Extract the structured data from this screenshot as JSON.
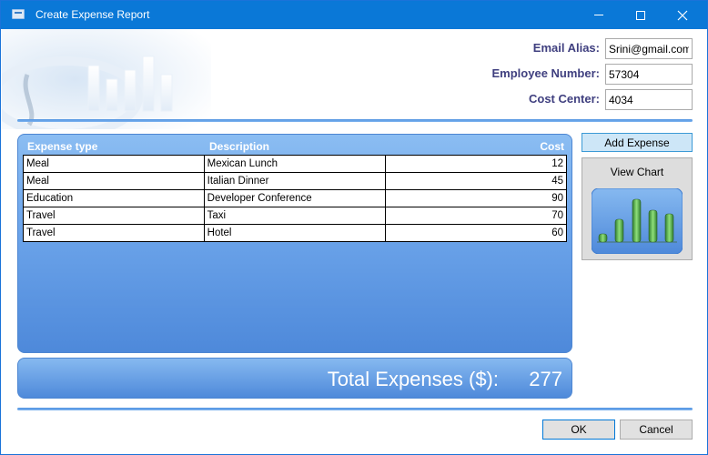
{
  "window": {
    "title": "Create Expense Report",
    "controls": [
      "minimize",
      "maximize",
      "close"
    ]
  },
  "form": {
    "email_label": "Email Alias:",
    "email_value": "Srini@gmail.com",
    "employee_label": "Employee Number:",
    "employee_value": "57304",
    "cost_center_label": "Cost Center:",
    "cost_center_value": "4034"
  },
  "grid": {
    "columns": [
      "Expense type",
      "Description",
      "Cost"
    ],
    "rows": [
      {
        "type": "Meal",
        "description": "Mexican Lunch",
        "cost": "12"
      },
      {
        "type": "Meal",
        "description": "Italian Dinner",
        "cost": "45"
      },
      {
        "type": "Education",
        "description": "Developer Conference",
        "cost": "90"
      },
      {
        "type": "Travel",
        "description": "Taxi",
        "cost": "70"
      },
      {
        "type": "Travel",
        "description": "Hotel",
        "cost": "60"
      }
    ]
  },
  "total": {
    "label": "Total Expenses ($):",
    "value": "277"
  },
  "actions": {
    "add_expense": "Add Expense",
    "view_chart": "View Chart",
    "ok": "OK",
    "cancel": "Cancel"
  },
  "colors": {
    "title_bar": "#0a78d7",
    "label_text": "#3f3f7f",
    "panel_blue": "#6ea6eb"
  }
}
